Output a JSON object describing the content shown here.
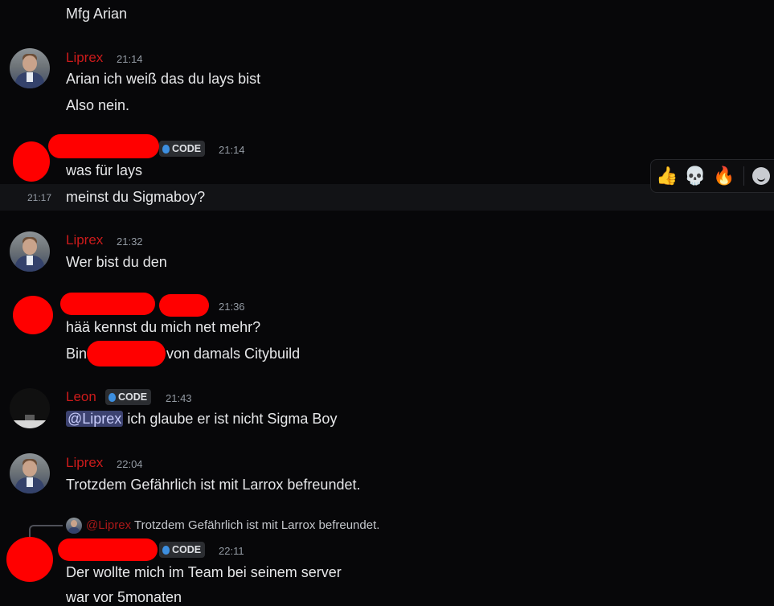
{
  "messages": {
    "top_line": "Mfg Arian",
    "m1": {
      "author": "Liprex",
      "time": "21:14",
      "lines": [
        "Arian ich weiß das du lays bist",
        "Also nein."
      ]
    },
    "m2": {
      "tag": "CODE",
      "time": "21:14",
      "lines": [
        "was für lays"
      ]
    },
    "m2b": {
      "hover_time": "21:17",
      "text": "meinst du Sigmaboy?"
    },
    "m3": {
      "author": "Liprex",
      "time": "21:32",
      "lines": [
        "Wer bist du den"
      ]
    },
    "m4": {
      "time": "21:36",
      "line1": "hää kennst du mich net mehr?",
      "line2_prefix": "Bin",
      "line2_suffix": "von damals Citybuild"
    },
    "m5": {
      "author": "Leon",
      "tag": "CODE",
      "time": "21:43",
      "mention": "@Liprex",
      "text": " ich glaube er ist nicht Sigma Boy"
    },
    "m6": {
      "author": "Liprex",
      "time": "22:04",
      "lines": [
        "Trotzdem Gefährlich ist mit Larrox befreundet."
      ]
    },
    "m7": {
      "reply_author": "@Liprex",
      "reply_text": "Trotzdem Gefährlich ist mit Larrox befreundet.",
      "tag": "CODE",
      "time": "22:11",
      "lines": [
        "Der wollte mich im Team bei seinem server",
        "war vor 5monaten"
      ]
    }
  },
  "toolbar": {
    "reactions": [
      {
        "icon": "thumbs-up-icon",
        "glyph": "👍"
      },
      {
        "icon": "skull-icon",
        "glyph": "💀"
      },
      {
        "icon": "fire-icon",
        "glyph": "🔥"
      }
    ],
    "add_reaction_icon": "add-reaction-icon"
  },
  "colors": {
    "background": "#070709",
    "author": "#cc1b1b",
    "mention_bg": "#3c4270",
    "tag_bg": "#2b2d31"
  }
}
